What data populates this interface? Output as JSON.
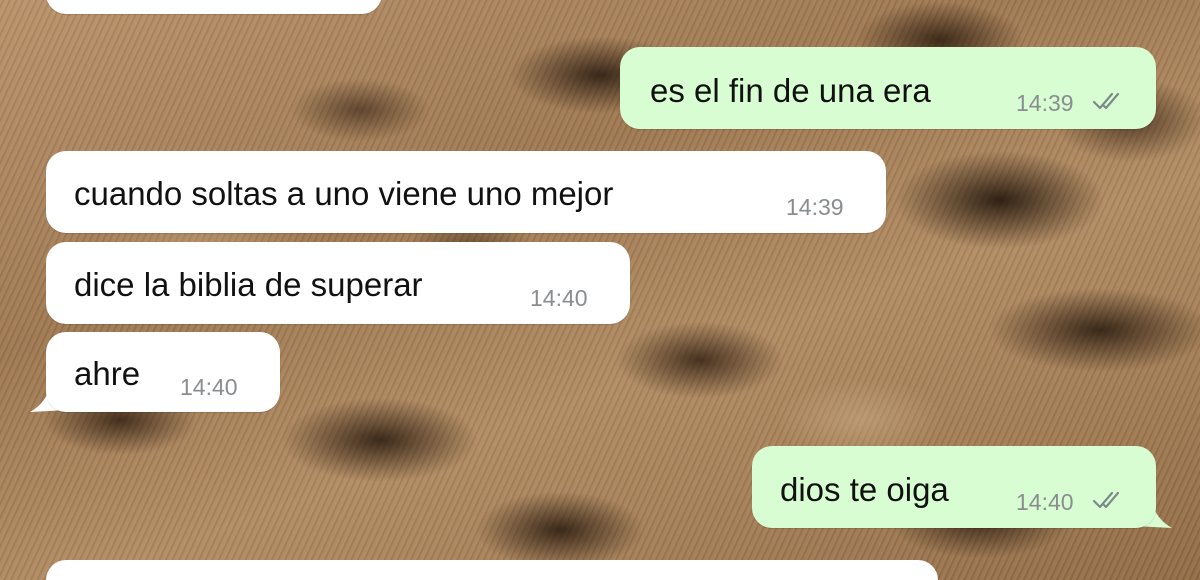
{
  "colors": {
    "incoming_bubble": "#ffffff",
    "outgoing_bubble": "#d9fdd3",
    "timestamp": "#8a8d90",
    "read_ticks": "#7d8a8a"
  },
  "messages": [
    {
      "direction": "outgoing",
      "text": "es el fin de una era",
      "time": "14:39",
      "status_icon": "double-check-icon"
    },
    {
      "direction": "incoming",
      "text": "cuando soltas a uno viene uno mejor",
      "time": "14:39"
    },
    {
      "direction": "incoming",
      "text": "dice la biblia de superar",
      "time": "14:40"
    },
    {
      "direction": "incoming",
      "text": "ahre",
      "time": "14:40"
    },
    {
      "direction": "outgoing",
      "text": "dios te oiga",
      "time": "14:40",
      "status_icon": "double-check-icon"
    }
  ]
}
